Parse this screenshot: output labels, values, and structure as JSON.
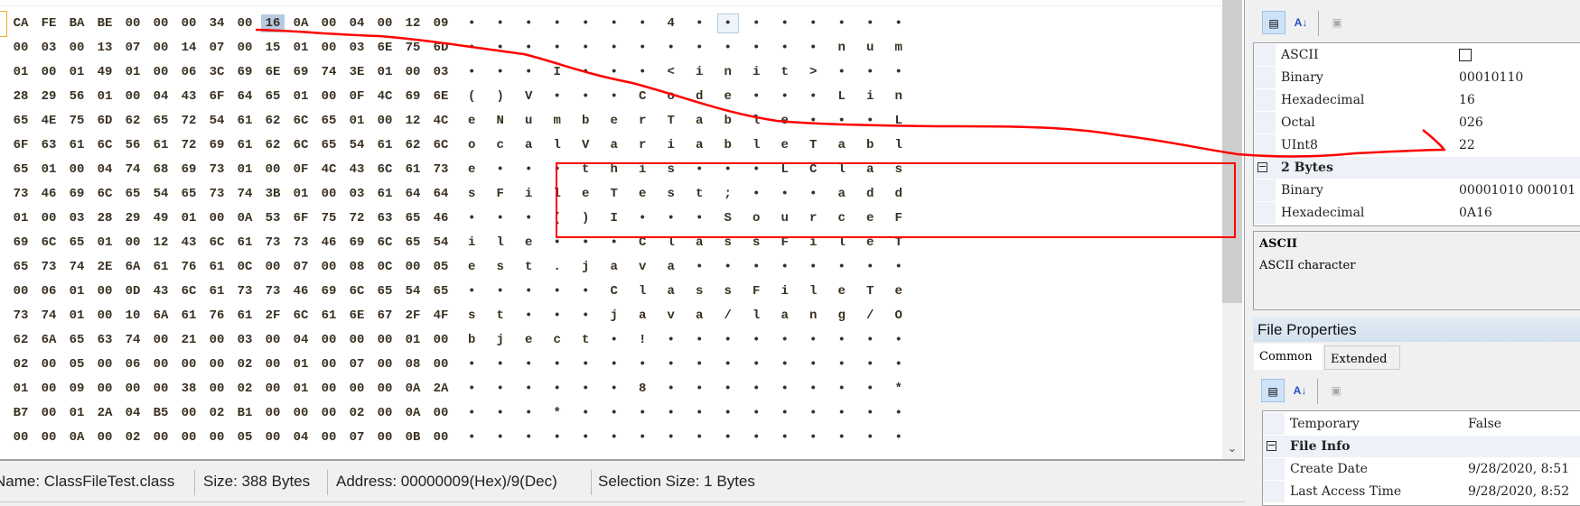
{
  "hex_view": {
    "rows": [
      [
        "CA",
        "FE",
        "BA",
        "BE",
        "00",
        "00",
        "00",
        "34",
        "00",
        "16",
        "0A",
        "00",
        "04",
        "00",
        "12",
        "09"
      ],
      [
        "00",
        "03",
        "00",
        "13",
        "07",
        "00",
        "14",
        "07",
        "00",
        "15",
        "01",
        "00",
        "03",
        "6E",
        "75",
        "6D"
      ],
      [
        "01",
        "00",
        "01",
        "49",
        "01",
        "00",
        "06",
        "3C",
        "69",
        "6E",
        "69",
        "74",
        "3E",
        "01",
        "00",
        "03"
      ],
      [
        "28",
        "29",
        "56",
        "01",
        "00",
        "04",
        "43",
        "6F",
        "64",
        "65",
        "01",
        "00",
        "0F",
        "4C",
        "69",
        "6E"
      ],
      [
        "65",
        "4E",
        "75",
        "6D",
        "62",
        "65",
        "72",
        "54",
        "61",
        "62",
        "6C",
        "65",
        "01",
        "00",
        "12",
        "4C"
      ],
      [
        "6F",
        "63",
        "61",
        "6C",
        "56",
        "61",
        "72",
        "69",
        "61",
        "62",
        "6C",
        "65",
        "54",
        "61",
        "62",
        "6C"
      ],
      [
        "65",
        "01",
        "00",
        "04",
        "74",
        "68",
        "69",
        "73",
        "01",
        "00",
        "0F",
        "4C",
        "43",
        "6C",
        "61",
        "73"
      ],
      [
        "73",
        "46",
        "69",
        "6C",
        "65",
        "54",
        "65",
        "73",
        "74",
        "3B",
        "01",
        "00",
        "03",
        "61",
        "64",
        "64"
      ],
      [
        "01",
        "00",
        "03",
        "28",
        "29",
        "49",
        "01",
        "00",
        "0A",
        "53",
        "6F",
        "75",
        "72",
        "63",
        "65",
        "46"
      ],
      [
        "69",
        "6C",
        "65",
        "01",
        "00",
        "12",
        "43",
        "6C",
        "61",
        "73",
        "73",
        "46",
        "69",
        "6C",
        "65",
        "54"
      ],
      [
        "65",
        "73",
        "74",
        "2E",
        "6A",
        "61",
        "76",
        "61",
        "0C",
        "00",
        "07",
        "00",
        "08",
        "0C",
        "00",
        "05"
      ],
      [
        "00",
        "06",
        "01",
        "00",
        "0D",
        "43",
        "6C",
        "61",
        "73",
        "73",
        "46",
        "69",
        "6C",
        "65",
        "54",
        "65"
      ],
      [
        "73",
        "74",
        "01",
        "00",
        "10",
        "6A",
        "61",
        "76",
        "61",
        "2F",
        "6C",
        "61",
        "6E",
        "67",
        "2F",
        "4F"
      ],
      [
        "62",
        "6A",
        "65",
        "63",
        "74",
        "00",
        "21",
        "00",
        "03",
        "00",
        "04",
        "00",
        "00",
        "00",
        "01",
        "00"
      ],
      [
        "02",
        "00",
        "05",
        "00",
        "06",
        "00",
        "00",
        "00",
        "02",
        "00",
        "01",
        "00",
        "07",
        "00",
        "08",
        "00"
      ],
      [
        "01",
        "00",
        "09",
        "00",
        "00",
        "00",
        "38",
        "00",
        "02",
        "00",
        "01",
        "00",
        "00",
        "00",
        "0A",
        "2A"
      ],
      [
        "B7",
        "00",
        "01",
        "2A",
        "04",
        "B5",
        "00",
        "02",
        "B1",
        "00",
        "00",
        "00",
        "02",
        "00",
        "0A",
        "00"
      ],
      [
        "00",
        "00",
        "0A",
        "00",
        "02",
        "00",
        "00",
        "00",
        "05",
        "00",
        "04",
        "00",
        "07",
        "00",
        "0B",
        "00"
      ]
    ],
    "ascii": [
      "•••••••4••••••••",
      "•••••••••••••num",
      "•••I•••<init>•••",
      "()V•••Code•••Lin",
      "eNumberTable•••L",
      "ocalVariableTabl",
      "e•••this•••LClas",
      "sFileTest;•••add",
      "•••()I•••SourceF",
      "ile•••ClassFileT",
      "est.java••••••••",
      "•••••ClassFileTe",
      "st•••java/lang/O",
      "bject•!•••••••••",
      "••••••••••••••••",
      "••••••8••••••••*",
      "•••*••••••••••••",
      "••••••••••••••••"
    ],
    "selected": {
      "row": 0,
      "col": 9
    },
    "selection_color": "#b8c9e2"
  },
  "status_bar": {
    "name": "Name: ClassFileTest.class",
    "size": "Size: 388 Bytes",
    "address": "Address: 00000009(Hex)/9(Dec)",
    "selection": "Selection Size: 1 Bytes"
  },
  "data_inspector": {
    "rows": [
      {
        "name": "ASCII",
        "value": ""
      },
      {
        "name": "Binary",
        "value": "00010110"
      },
      {
        "name": "Hexadecimal",
        "value": "16"
      },
      {
        "name": "Octal",
        "value": "026"
      },
      {
        "name": "UInt8",
        "value": "22"
      }
    ],
    "category_2bytes": "2 Bytes",
    "rows2": [
      {
        "name": "Binary",
        "value": "00001010 000101"
      },
      {
        "name": "Hexadecimal",
        "value": "0A16"
      }
    ],
    "description_title": "ASCII",
    "description_text": "ASCII character"
  },
  "file_properties": {
    "title": "File Properties",
    "tabs": [
      "Common",
      "Extended"
    ],
    "active_tab": "Common",
    "rows": [
      {
        "name": "Temporary",
        "value": "False"
      }
    ],
    "category_file_info": "File Info",
    "file_info_rows": [
      {
        "name": "Create Date",
        "value": "9/28/2020, 8:51"
      },
      {
        "name": "Last Access Time",
        "value": "9/28/2020, 8:52"
      }
    ]
  },
  "toolbar_icons": [
    "categorized-icon",
    "alphabetical-sort-icon",
    "property-pages-icon"
  ],
  "annotation_color": "#ff0000"
}
